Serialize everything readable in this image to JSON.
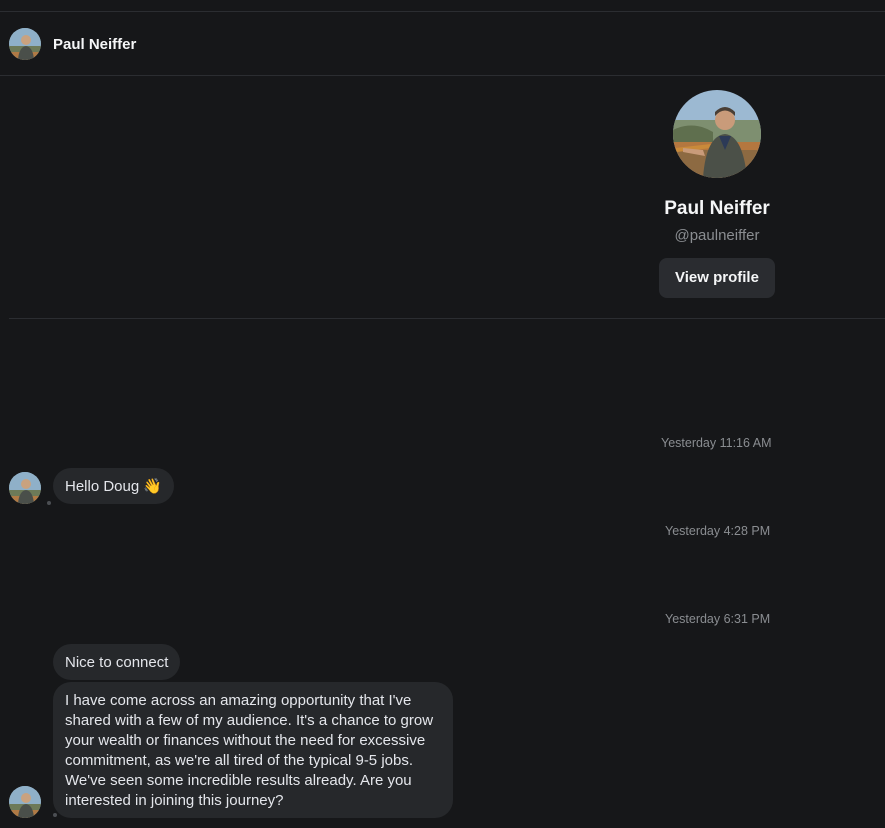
{
  "conversation": {
    "contact_name": "Paul Neiffer",
    "contact_handle": "@paulneiffer",
    "view_profile_label": "View profile"
  },
  "timestamps": [
    "Yesterday 11:16 AM",
    "Yesterday 4:28 PM",
    "Yesterday 6:31 PM"
  ],
  "messages": [
    {
      "text": "Hello Doug 👋"
    },
    {
      "text": "Nice to connect"
    },
    {
      "text": "I have come across an amazing opportunity that I've shared with a few of my audience. It's a chance to grow your wealth or finances without the need for excessive commitment, as we're all tired of the typical 9-5 jobs. We've seen some incredible results already. Are you interested in joining this journey?"
    }
  ],
  "icons": [
    "avatar-image",
    "waving-hand-emoji"
  ]
}
